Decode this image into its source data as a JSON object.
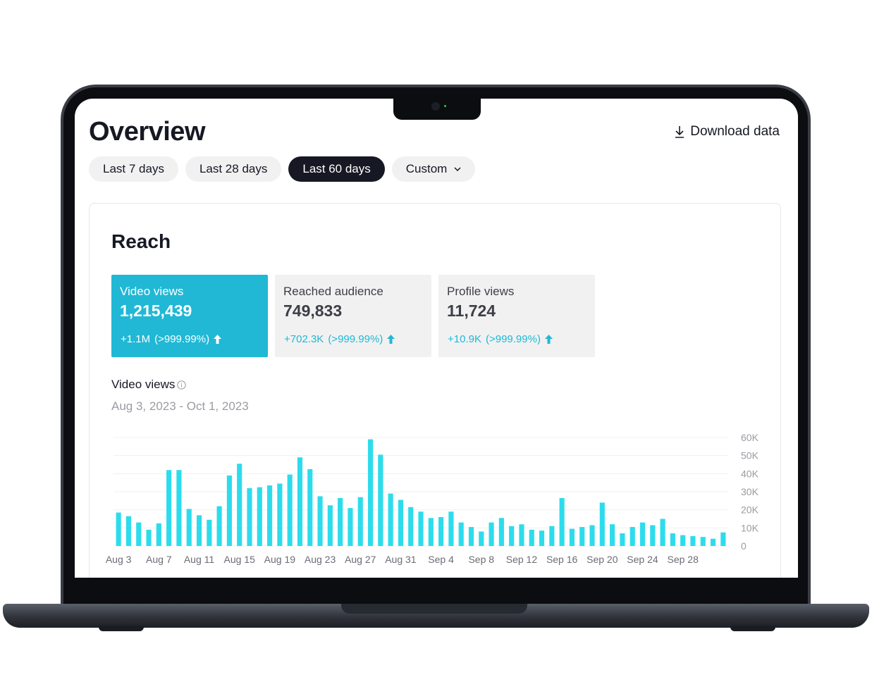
{
  "header": {
    "title": "Overview",
    "download_label": "Download data"
  },
  "tabs": [
    {
      "label": "Last 7 days",
      "active": false
    },
    {
      "label": "Last 28 days",
      "active": false
    },
    {
      "label": "Last 60 days",
      "active": true
    },
    {
      "label": "Custom",
      "active": false,
      "has_dropdown": true
    }
  ],
  "reach": {
    "title": "Reach",
    "metrics": [
      {
        "label": "Video views",
        "value": "1,215,439",
        "delta": "+1.1M",
        "delta_pct": "(>999.99%)",
        "active": true
      },
      {
        "label": "Reached audience",
        "value": "749,833",
        "delta": "+702.3K",
        "delta_pct": "(>999.99%)",
        "active": false
      },
      {
        "label": "Profile views",
        "value": "11,724",
        "delta": "+10.9K",
        "delta_pct": "(>999.99%)",
        "active": false
      }
    ],
    "chart_title": "Video views",
    "chart_range": "Aug 3, 2023 - Oct 1, 2023"
  },
  "colors": {
    "accent": "#20b8d5",
    "bar": "#2ddcec",
    "text_dark": "#161823",
    "muted": "#9b9ba3"
  },
  "chart_data": {
    "type": "bar",
    "x": [
      "Aug 3",
      "Aug 4",
      "Aug 5",
      "Aug 6",
      "Aug 7",
      "Aug 8",
      "Aug 9",
      "Aug 10",
      "Aug 11",
      "Aug 12",
      "Aug 13",
      "Aug 14",
      "Aug 15",
      "Aug 16",
      "Aug 17",
      "Aug 18",
      "Aug 19",
      "Aug 20",
      "Aug 21",
      "Aug 22",
      "Aug 23",
      "Aug 24",
      "Aug 25",
      "Aug 26",
      "Aug 27",
      "Aug 28",
      "Aug 29",
      "Aug 30",
      "Aug 31",
      "Sep 1",
      "Sep 2",
      "Sep 3",
      "Sep 4",
      "Sep 5",
      "Sep 6",
      "Sep 7",
      "Sep 8",
      "Sep 9",
      "Sep 10",
      "Sep 11",
      "Sep 12",
      "Sep 13",
      "Sep 14",
      "Sep 15",
      "Sep 16",
      "Sep 17",
      "Sep 18",
      "Sep 19",
      "Sep 20",
      "Sep 21",
      "Sep 22",
      "Sep 23",
      "Sep 24",
      "Sep 25",
      "Sep 26",
      "Sep 27",
      "Sep 28",
      "Sep 29",
      "Sep 30",
      "Oct 1"
    ],
    "values": [
      18500,
      16500,
      13000,
      9000,
      12500,
      42000,
      42000,
      20500,
      17000,
      14500,
      22000,
      39000,
      45500,
      32000,
      32500,
      33500,
      34500,
      39500,
      49000,
      42500,
      27500,
      22500,
      26500,
      21000,
      27000,
      59000,
      50500,
      29000,
      25500,
      21500,
      19000,
      15500,
      16000,
      19000,
      13000,
      10500,
      8000,
      13000,
      15500,
      11000,
      12000,
      9000,
      8500,
      11000,
      26500,
      9500,
      10500,
      11500,
      24000,
      12000,
      7000,
      10500,
      13000,
      11500,
      15000,
      7000,
      6000,
      5500,
      5000,
      4000,
      7500
    ],
    "x_tick_labels": [
      "Aug 3",
      "Aug 7",
      "Aug 11",
      "Aug 15",
      "Aug 19",
      "Aug 23",
      "Aug 27",
      "Aug 31",
      "Sep 4",
      "Sep 8",
      "Sep 12",
      "Sep 16",
      "Sep 20",
      "Sep 24",
      "Sep 28"
    ],
    "y_tick_labels": [
      "60K",
      "50K",
      "40K",
      "30K",
      "20K",
      "10K",
      "0"
    ],
    "ylim": [
      0,
      60000
    ],
    "grid": true
  }
}
